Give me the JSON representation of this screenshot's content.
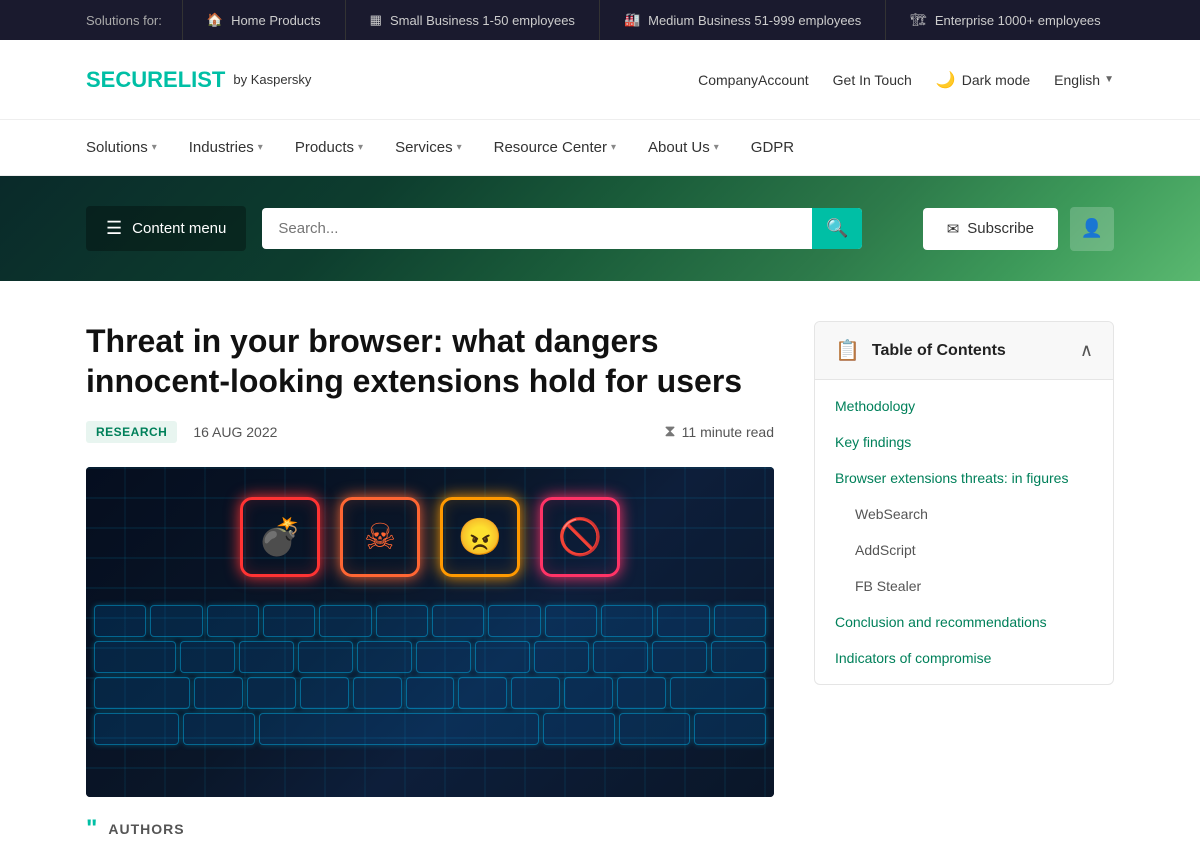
{
  "topbar": {
    "solutions_label": "Solutions for:",
    "items": [
      {
        "id": "home",
        "label": "Home Products",
        "icon": "🏠"
      },
      {
        "id": "small-biz",
        "label": "Small Business 1-50 employees",
        "icon": "🏢"
      },
      {
        "id": "medium-biz",
        "label": "Medium Business 51-999 employees",
        "icon": "🏭"
      },
      {
        "id": "enterprise",
        "label": "Enterprise 1000+ employees",
        "icon": "🏗"
      }
    ]
  },
  "header": {
    "logo_secure": "SECURE",
    "logo_list": "LIST",
    "logo_by": "by Kaspersky",
    "company_account": "CompanyAccount",
    "get_in_touch": "Get In Touch",
    "dark_mode": "Dark mode",
    "language": "English"
  },
  "nav": {
    "items": [
      {
        "id": "solutions",
        "label": "Solutions",
        "has_dropdown": true
      },
      {
        "id": "industries",
        "label": "Industries",
        "has_dropdown": true
      },
      {
        "id": "products",
        "label": "Products",
        "has_dropdown": true
      },
      {
        "id": "services",
        "label": "Services",
        "has_dropdown": true
      },
      {
        "id": "resource-center",
        "label": "Resource Center",
        "has_dropdown": true
      },
      {
        "id": "about-us",
        "label": "About Us",
        "has_dropdown": true
      },
      {
        "id": "gdpr",
        "label": "GDPR",
        "has_dropdown": false
      }
    ]
  },
  "search_bar": {
    "content_menu_label": "Content menu",
    "search_placeholder": "Search...",
    "subscribe_label": "Subscribe"
  },
  "article": {
    "title": "Threat in your browser: what dangers innocent-looking extensions hold for users",
    "badge": "RESEARCH",
    "date": "16 AUG 2022",
    "read_time": "11 minute read",
    "authors_label": "AUTHORS"
  },
  "toc": {
    "title": "Table of Contents",
    "items": [
      {
        "id": "methodology",
        "label": "Methodology",
        "sub": false
      },
      {
        "id": "key-findings",
        "label": "Key findings",
        "sub": false
      },
      {
        "id": "browser-extensions",
        "label": "Browser extensions threats: in figures",
        "sub": false
      },
      {
        "id": "websearch",
        "label": "WebSearch",
        "sub": true
      },
      {
        "id": "addscript",
        "label": "AddScript",
        "sub": true
      },
      {
        "id": "fb-stealer",
        "label": "FB Stealer",
        "sub": true
      },
      {
        "id": "conclusion",
        "label": "Conclusion and recommendations",
        "sub": false
      },
      {
        "id": "indicators",
        "label": "Indicators of compromise",
        "sub": false
      }
    ]
  },
  "colors": {
    "brand_green": "#00bfa5",
    "dark_green": "#00805a",
    "toc_green": "#00805a"
  }
}
